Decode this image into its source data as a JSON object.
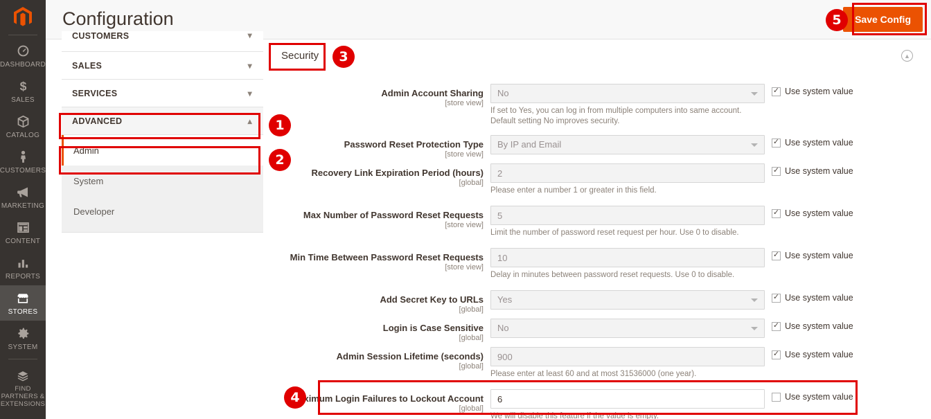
{
  "header": {
    "title": "Configuration",
    "save_label": "Save Config",
    "logo_icon": "magento-logo-icon"
  },
  "admin_rail": {
    "items": [
      {
        "label": "DASHBOARD",
        "icon": "dashboard-gauge-icon",
        "active": false
      },
      {
        "label": "SALES",
        "icon": "dollar-sign-icon",
        "active": false
      },
      {
        "label": "CATALOG",
        "icon": "box-icon",
        "active": false
      },
      {
        "label": "CUSTOMERS",
        "icon": "person-icon",
        "active": false
      },
      {
        "label": "MARKETING",
        "icon": "megaphone-icon",
        "active": false
      },
      {
        "label": "CONTENT",
        "icon": "layout-page-icon",
        "active": false
      },
      {
        "label": "REPORTS",
        "icon": "bar-chart-icon",
        "active": false
      },
      {
        "label": "STORES",
        "icon": "storefront-icon",
        "active": true
      },
      {
        "label": "SYSTEM",
        "icon": "gear-icon",
        "active": false
      },
      {
        "label": "FIND PARTNERS & EXTENSIONS",
        "icon": "extension-box-icon",
        "active": false
      }
    ]
  },
  "config_nav": {
    "sections": [
      {
        "label": "CUSTOMERS",
        "state": "collapsed",
        "chevron": "chevron-down-icon"
      },
      {
        "label": "SALES",
        "state": "collapsed",
        "chevron": "chevron-down-icon"
      },
      {
        "label": "SERVICES",
        "state": "collapsed",
        "chevron": "chevron-down-icon"
      },
      {
        "label": "ADVANCED",
        "state": "expanded",
        "chevron": "chevron-up-icon"
      }
    ],
    "advanced_children": [
      {
        "label": "Admin",
        "active": true
      },
      {
        "label": "System",
        "active": false
      },
      {
        "label": "Developer",
        "active": false
      }
    ]
  },
  "section_tab": {
    "label": "Security",
    "collapse_icon": "chevron-up-circle-icon"
  },
  "use_system_value_label": "Use system value",
  "fields": [
    {
      "label": "Admin Account Sharing",
      "scope": "[store view]",
      "type": "select",
      "value": "No",
      "note": "If set to Yes, you can log in from multiple computers into same account. Default setting No improves security.",
      "use_system_value": true,
      "disabled": true
    },
    {
      "label": "Password Reset Protection Type",
      "scope": "[store view]",
      "type": "select",
      "value": "By IP and Email",
      "note": "",
      "use_system_value": true,
      "disabled": true
    },
    {
      "label": "Recovery Link Expiration Period (hours)",
      "scope": "[global]",
      "type": "text",
      "value": "2",
      "note": "Please enter a number 1 or greater in this field.",
      "use_system_value": true,
      "disabled": true
    },
    {
      "label": "Max Number of Password Reset Requests",
      "scope": "[store view]",
      "type": "text",
      "value": "5",
      "note": "Limit the number of password reset request per hour. Use 0 to disable.",
      "use_system_value": true,
      "disabled": true
    },
    {
      "label": "Min Time Between Password Reset Requests",
      "scope": "[store view]",
      "type": "text",
      "value": "10",
      "note": "Delay in minutes between password reset requests. Use 0 to disable.",
      "use_system_value": true,
      "disabled": true
    },
    {
      "label": "Add Secret Key to URLs",
      "scope": "[global]",
      "type": "select",
      "value": "Yes",
      "note": "",
      "use_system_value": true,
      "disabled": true
    },
    {
      "label": "Login is Case Sensitive",
      "scope": "[global]",
      "type": "select",
      "value": "No",
      "note": "",
      "use_system_value": true,
      "disabled": true
    },
    {
      "label": "Admin Session Lifetime (seconds)",
      "scope": "[global]",
      "type": "text",
      "value": "900",
      "note": "Please enter at least 60 and at most 31536000 (one year).",
      "use_system_value": true,
      "disabled": true
    },
    {
      "label": "Maximum Login Failures to Lockout Account",
      "scope": "[global]",
      "type": "text",
      "value": "6",
      "note": "We will disable this feature if the value is empty.",
      "use_system_value": false,
      "disabled": false
    }
  ],
  "step_badges": [
    {
      "number": "1"
    },
    {
      "number": "2"
    },
    {
      "number": "3"
    },
    {
      "number": "4"
    },
    {
      "number": "5"
    }
  ],
  "colors": {
    "brand_orange": "#eb5202",
    "rail_dark": "#373330",
    "annotation_red": "#e00000",
    "text_dark": "#41362f"
  }
}
